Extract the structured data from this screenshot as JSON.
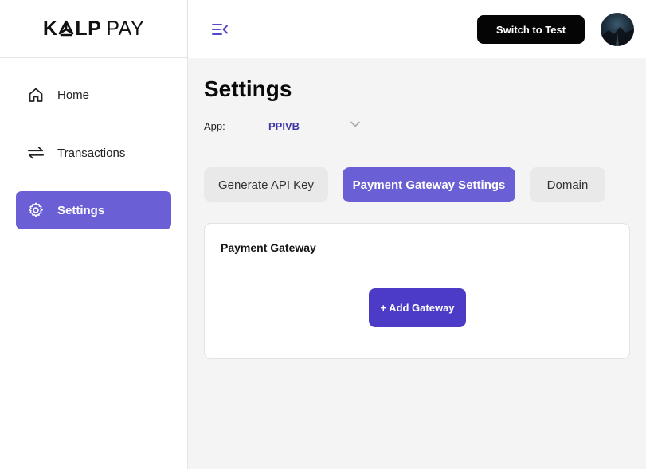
{
  "brand": {
    "name_strong_left": "K",
    "name_strong_right": "LP",
    "name_light": "PAY",
    "accent_color": "#6b5fd6"
  },
  "sidebar": {
    "items": [
      {
        "label": "Home",
        "icon": "home-icon",
        "active": false
      },
      {
        "label": "Transactions",
        "icon": "swap-arrows-icon",
        "active": false
      },
      {
        "label": "Settings",
        "icon": "gear-icon",
        "active": true
      }
    ]
  },
  "header": {
    "menu_icon": "menu-collapse-icon",
    "switch_label": "Switch to Test",
    "avatar_icon": "user-avatar"
  },
  "page": {
    "title": "Settings",
    "app_label": "App:",
    "app_value": "PPIVB"
  },
  "tabs": [
    {
      "label": "Generate API Key",
      "active": false
    },
    {
      "label": "Payment Gateway Settings",
      "active": true
    },
    {
      "label": "Domain",
      "active": false
    }
  ],
  "card": {
    "title": "Payment Gateway",
    "add_button_label": "+ Add Gateway"
  },
  "colors": {
    "primary_button": "#4b3bc7",
    "dark_button": "#050505",
    "app_value": "#3d35a8",
    "background": "#f4f4f4"
  }
}
